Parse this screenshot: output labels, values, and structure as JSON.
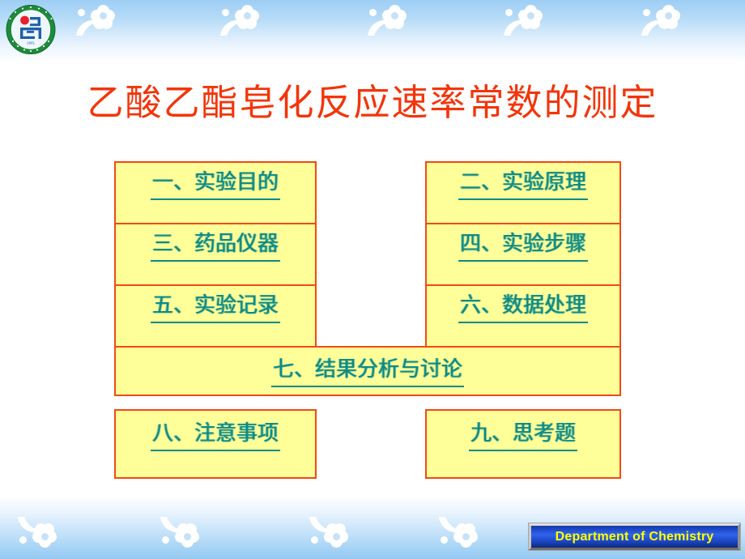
{
  "slide": {
    "title": "乙酸乙酯皂化反应速率常数的测定",
    "title_color": "#f4340a",
    "background_color": "#ffffff"
  },
  "logo": {
    "name": "shandong-university-emblem",
    "ring_color": "#1e8a3c",
    "dot_color": "#e8202a",
    "glyph_color": "#1f5fa8",
    "top_text": "山 东 大 学",
    "bottom_text": "SHANDONG UNIVERSITY",
    "year_text": "1901"
  },
  "decor": {
    "top_band_color_start": "#9ecef5",
    "top_band_color_end": "#ffffff",
    "bottom_band_color_start": "#ffffff",
    "bottom_band_color_end": "#93c9f3",
    "flower_color": "#ffffff",
    "flower_name": "blossom-decoration"
  },
  "menu": {
    "cell_background": "#ffff99",
    "cell_border_color": "#f04a16",
    "label_color": "#0c8a87",
    "items": [
      {
        "id": "c1",
        "label": "一、实验目的"
      },
      {
        "id": "c2",
        "label": "二、实验原理"
      },
      {
        "id": "c3",
        "label": "三、药品仪器"
      },
      {
        "id": "c4",
        "label": "四、实验步骤"
      },
      {
        "id": "c5",
        "label": "五、实验记录"
      },
      {
        "id": "c6",
        "label": "六、数据处理"
      },
      {
        "id": "c7",
        "label": "七、结果分析与讨论"
      },
      {
        "id": "c8",
        "label": "八、注意事项"
      },
      {
        "id": "c9",
        "label": "九、思考题"
      }
    ]
  },
  "footer": {
    "label": "Department of Chemistry",
    "text_color": "#ffff00",
    "background_color": "#1c46c8",
    "border_color": "#b0b0b0"
  }
}
